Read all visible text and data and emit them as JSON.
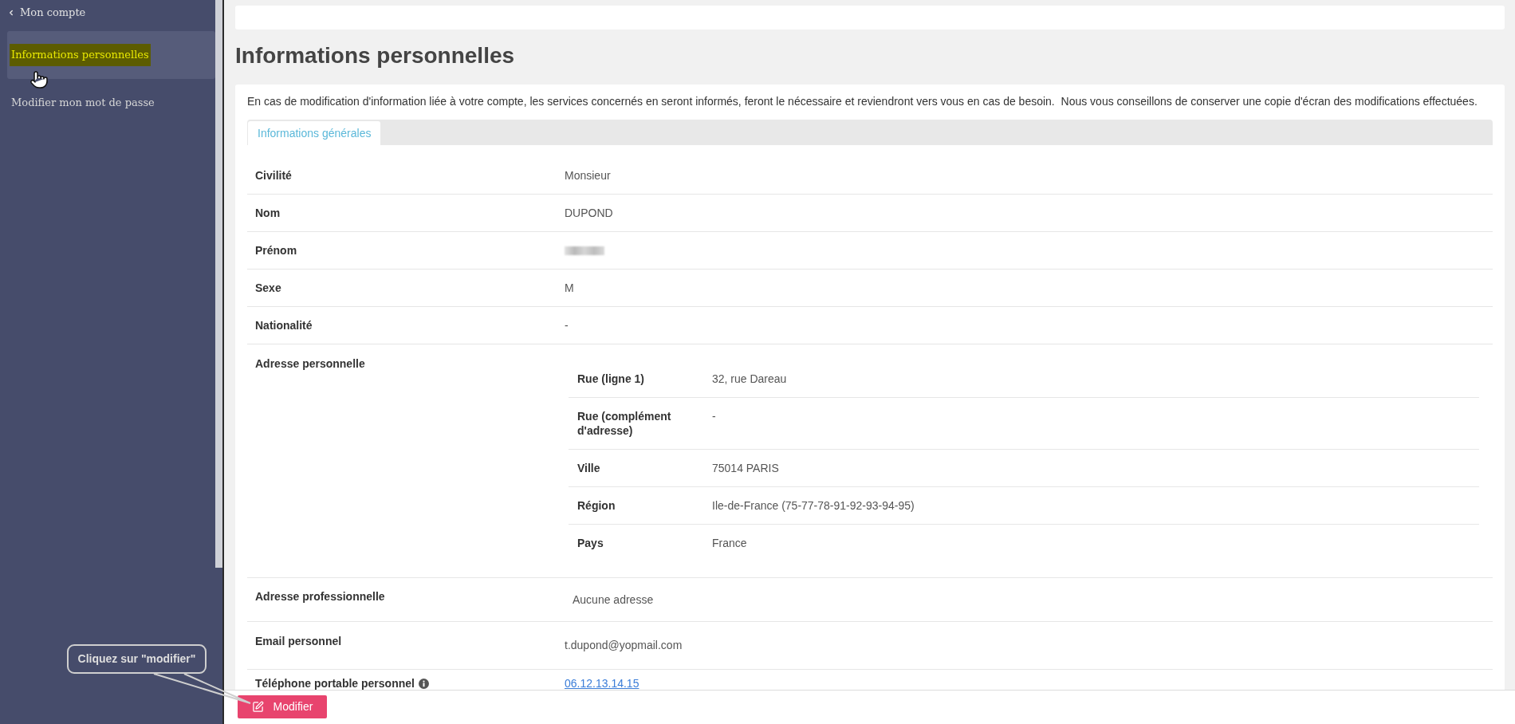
{
  "sidebar": {
    "back_link": "Mon compte",
    "items": [
      {
        "label": "Informations personnelles",
        "selected": true
      },
      {
        "label": "Modifier mon mot de passe",
        "selected": false
      }
    ]
  },
  "page": {
    "title": "Informations personnelles",
    "notice": "En cas de modification d'information liée à votre compte, les services concernés en seront informés, feront le nécessaire et reviendront vers vous en cas de besoin.  Nous vous conseillons de conserver une copie d'écran des modifications effectuées."
  },
  "tabs": [
    {
      "label": "Informations générales",
      "selected": true
    }
  ],
  "fields": [
    {
      "label": "Civilité",
      "kind": "text",
      "value": "Monsieur"
    },
    {
      "label": "Nom",
      "kind": "text",
      "value": "DUPOND"
    },
    {
      "label": "Prénom",
      "kind": "redacted"
    },
    {
      "label": "Sexe",
      "kind": "text",
      "value": "M"
    },
    {
      "label": "Nationalité",
      "kind": "text",
      "value": "-"
    },
    {
      "label": "Adresse personnelle",
      "kind": "address",
      "lines": [
        {
          "label": "Rue (ligne 1)",
          "value": "32, rue Dareau"
        },
        {
          "label": "Rue (complément d'adresse)",
          "value": "-"
        },
        {
          "label": "Ville",
          "value": "75014 PARIS"
        },
        {
          "label": "Région",
          "value": "Ile-de-France (75-77-78-91-92-93-94-95)"
        },
        {
          "label": "Pays",
          "value": "France"
        }
      ]
    },
    {
      "label": "Adresse professionnelle",
      "kind": "address",
      "empty_text": "Aucune adresse"
    },
    {
      "label": "Email personnel",
      "kind": "contact",
      "value": "t.dupond@yopmail.com"
    },
    {
      "label": "Téléphone portable personnel",
      "kind": "link",
      "value": "06.12.13.14.15",
      "info": true
    }
  ],
  "footer": {
    "button": "Modifier"
  },
  "callout": {
    "text": "Cliquez sur \"modifier\""
  }
}
